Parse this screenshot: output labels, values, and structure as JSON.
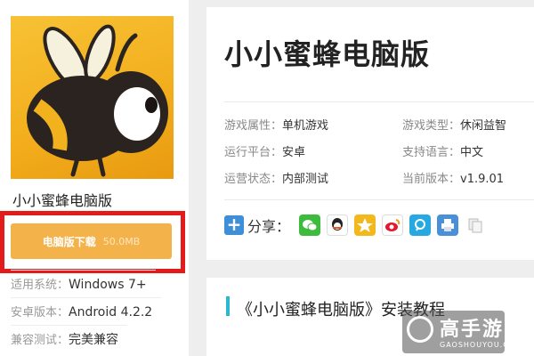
{
  "app": {
    "name": "小小蜜蜂电脑版",
    "download_label": "电脑版下载",
    "download_size": "50.0MB"
  },
  "left_info": [
    {
      "key": "适用系统：",
      "value": "Windows 7+"
    },
    {
      "key": "安卓版本：",
      "value": "Android 4.2.2"
    },
    {
      "key": "兼容测试：",
      "value": "完美兼容"
    }
  ],
  "detail": {
    "title": "小小蜜蜂电脑版",
    "attrs": [
      {
        "key": "游戏属性：",
        "value": "单机游戏"
      },
      {
        "key": "游戏类型：",
        "value": "休闲益智"
      },
      {
        "key": "运行平台：",
        "value": "安卓"
      },
      {
        "key": "支持语言：",
        "value": "中文"
      },
      {
        "key": "运营状态：",
        "value": "内部测试"
      },
      {
        "key": "当前版本：",
        "value": "v1.9.01"
      }
    ],
    "share_label": "分享：",
    "share_icons": [
      "wechat-icon",
      "qq-icon",
      "qzone-icon",
      "weibo-icon",
      "tencent-weibo-icon",
      "print-icon",
      "copy-icon"
    ]
  },
  "tutorial": {
    "title": "《小小蜜蜂电脑版》安装教程"
  },
  "watermark": {
    "brand": "高手游",
    "domain": "GAOSHOUYOU.COM"
  },
  "colors": {
    "download_button": "#f4b34a",
    "highlight_frame": "#e31b1b",
    "accent_bar": "#2bb7cc"
  }
}
